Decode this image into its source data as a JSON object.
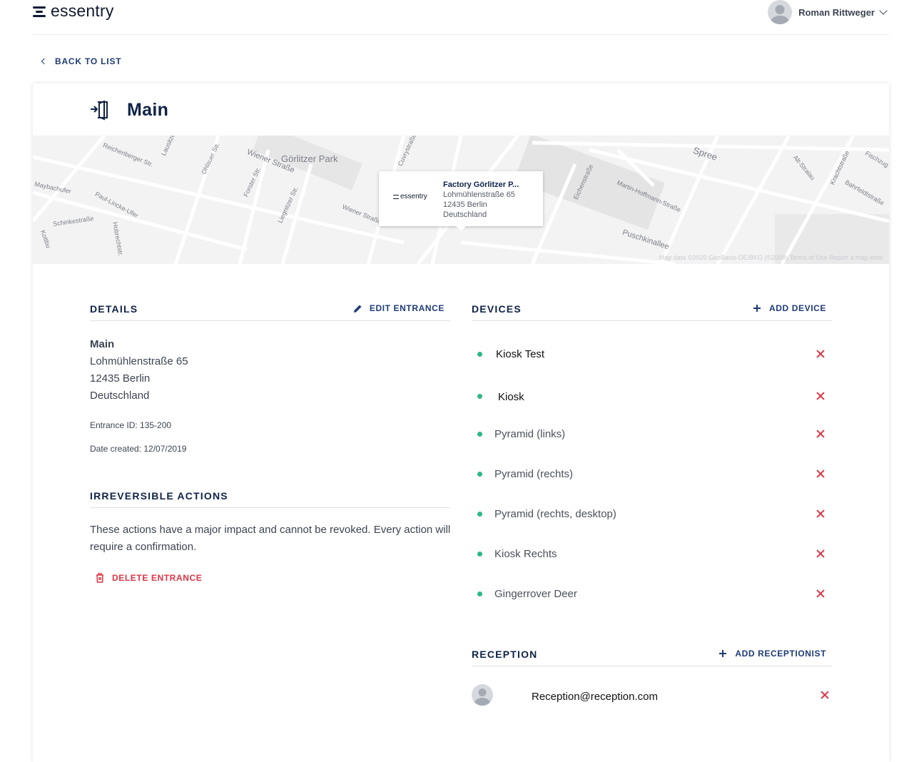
{
  "header": {
    "logo_text": "essentry",
    "user_name": "Roman Rittweger"
  },
  "nav": {
    "back_label": "BACK TO LIST"
  },
  "entrance": {
    "title": "Main"
  },
  "map": {
    "labels": [
      "Görlitzer Park",
      "Spree",
      "Reichenberger Str.",
      "Wiener Straße",
      "Wiener Straße",
      "Maybachufer",
      "Paul-Lincke-Ufer",
      "Schinkestraße",
      "Ohlauer Str.",
      "Forster Str.",
      "Liegnitzer Str.",
      "Lausitzer",
      "Cuvrystraße",
      "Eichenstraße",
      "Martin-Hoffmann-Straße",
      "Puschkinallee",
      "Alt-Stralau",
      "Krachtstraße",
      "Bahrfeldtstraße",
      "Fischzug",
      "Hobrechtstr.",
      "Kottbu"
    ],
    "popup": {
      "logo_text": "essentry",
      "name": "Factory Görlitzer P...",
      "street": "Lohmühlenstraße 65",
      "city": "12435 Berlin",
      "country": "Deutschland"
    },
    "footer": "Map data ©2020 GeoBasis-DE/BKG (©2009)   Terms of Use   Report a map error"
  },
  "details": {
    "heading": "DETAILS",
    "edit_label": "EDIT ENTRANCE",
    "name": "Main",
    "street": "Lohmühlenstraße 65",
    "city": "12435 Berlin",
    "country": "Deutschland",
    "entrance_id": "Entrance ID: 135-200",
    "date_created": "Date created: 12/07/2019"
  },
  "irreversible": {
    "heading": "IRREVERSIBLE ACTIONS",
    "text": "These actions have a major impact and cannot be revoked. Every action will require a confirmation.",
    "delete_label": "DELETE ENTRANCE"
  },
  "devices": {
    "heading": "DEVICES",
    "add_label": "ADD DEVICE",
    "items": [
      {
        "name": "Kiosk Test",
        "status": "online"
      },
      {
        "name": "Kiosk",
        "status": "online"
      },
      {
        "name": "Pyramid (links)",
        "status": "online"
      },
      {
        "name": "Pyramid (rechts)",
        "status": "online"
      },
      {
        "name": "Pyramid (rechts, desktop)",
        "status": "online"
      },
      {
        "name": "Kiosk Rechts",
        "status": "online"
      },
      {
        "name": "Gingerrover Deer",
        "status": "online"
      }
    ]
  },
  "reception": {
    "heading": "RECEPTION",
    "add_label": "ADD RECEPTIONIST",
    "items": [
      {
        "email": "Reception@reception.com"
      }
    ]
  },
  "colors": {
    "primary": "#1e3a78",
    "title": "#0f2348",
    "danger": "#dc3545",
    "status_online": "#2fb984"
  }
}
